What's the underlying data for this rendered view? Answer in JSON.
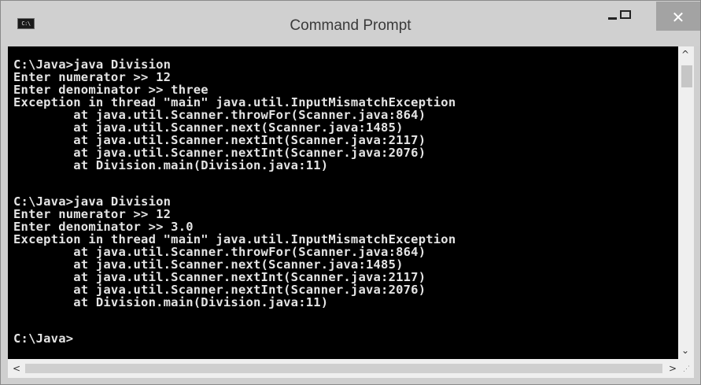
{
  "window": {
    "title": "Command Prompt",
    "icon": "cmd-icon",
    "icon_label": "C:\\",
    "controls": {
      "minimize": "minimize-icon",
      "maximize": "maximize-icon",
      "close": "close-icon",
      "close_glyph": "✕"
    }
  },
  "console": {
    "background": "#000000",
    "text_color": "#e4e4e4",
    "lines": [
      "C:\\Java>java Division",
      "Enter numerator >> 12",
      "Enter denominator >> three",
      "Exception in thread \"main\" java.util.InputMismatchException",
      "        at java.util.Scanner.throwFor(Scanner.java:864)",
      "        at java.util.Scanner.next(Scanner.java:1485)",
      "        at java.util.Scanner.nextInt(Scanner.java:2117)",
      "        at java.util.Scanner.nextInt(Scanner.java:2076)",
      "        at Division.main(Division.java:11)",
      "",
      "C:\\Java>java Division",
      "Enter numerator >> 12",
      "Enter denominator >> 3.0",
      "Exception in thread \"main\" java.util.InputMismatchException",
      "        at java.util.Scanner.throwFor(Scanner.java:864)",
      "        at java.util.Scanner.next(Scanner.java:1485)",
      "        at java.util.Scanner.nextInt(Scanner.java:2117)",
      "        at java.util.Scanner.nextInt(Scanner.java:2076)",
      "        at Division.main(Division.java:11)",
      "",
      "C:\\Java>"
    ]
  },
  "scrollbars": {
    "up": "^",
    "down": "⌄",
    "left": "<",
    "right": ">"
  }
}
